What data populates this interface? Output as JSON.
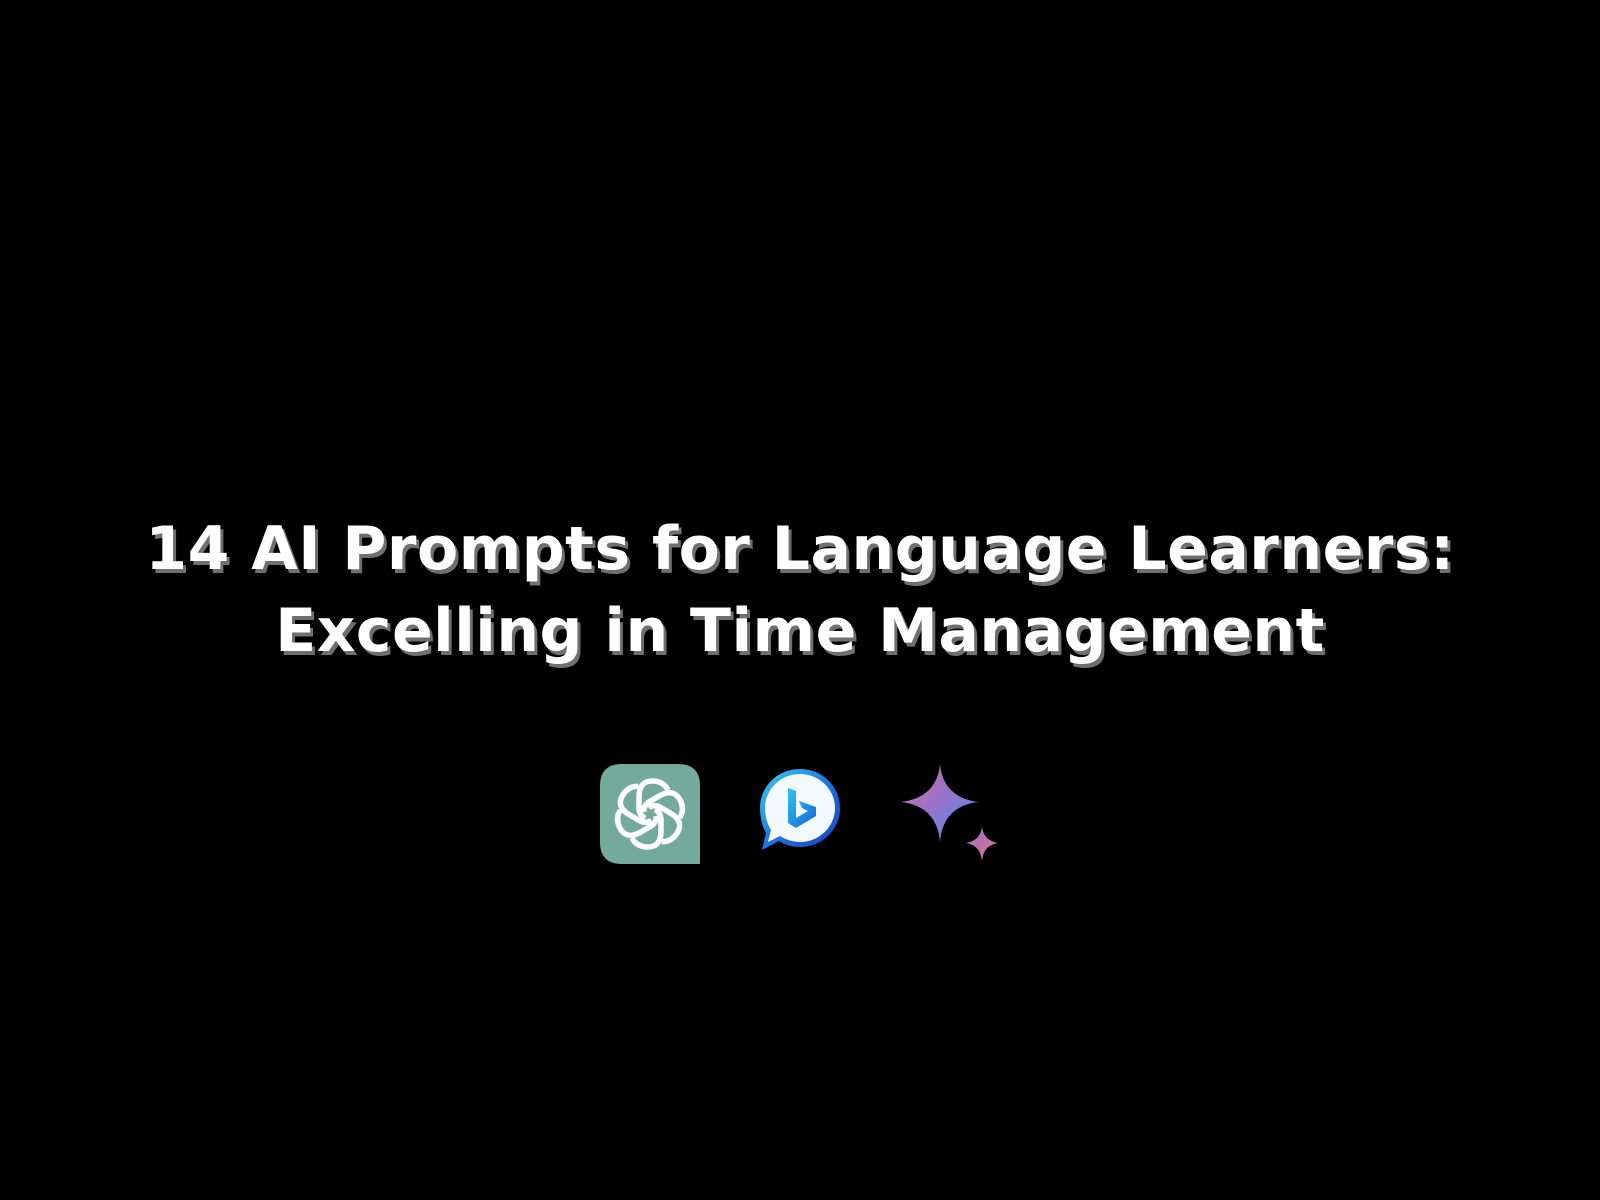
{
  "title": {
    "line1": "14 AI Prompts for Language Learners:",
    "line2": "Excelling in Time Management"
  },
  "logos": [
    {
      "icon": "chatgpt-logo-icon",
      "color": "#74aa9c"
    },
    {
      "icon": "bing-chat-logo-icon",
      "color": "#1b6fe0"
    },
    {
      "icon": "gemini-sparkle-logo-icon",
      "color": "#4b8fe8"
    }
  ],
  "colors": {
    "background": "#000000",
    "title_text": "#ffffff",
    "title_shadow": "#6f6f6f"
  }
}
